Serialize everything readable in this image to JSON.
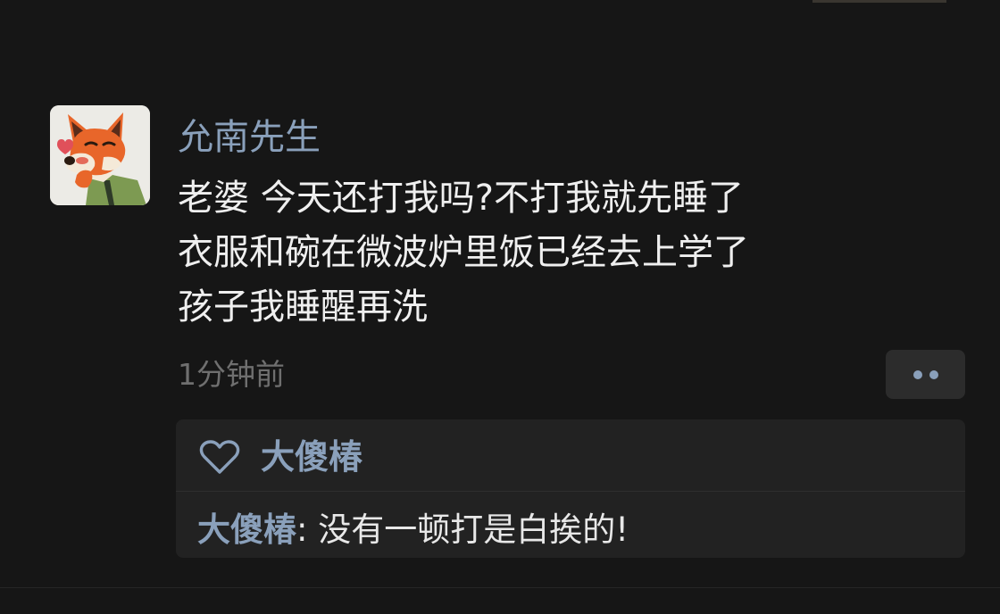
{
  "post": {
    "author": "允南先生",
    "body_lines": [
      "老婆 今天还打我吗?不打我就先睡了",
      "衣服和碗在微波炉里饭已经去上学了",
      "孩子我睡醒再洗"
    ],
    "timestamp": "1分钟前",
    "avatar_icon": "fox-cartoon-avatar",
    "more_icon": "two-dots-icon"
  },
  "interactions": {
    "like_icon": "heart-outline-icon",
    "likers": "大傻椿",
    "comments": [
      {
        "author": "大傻椿",
        "separator": ": ",
        "text": "没有一顿打是白挨的!"
      }
    ]
  },
  "colors": {
    "background": "#161616",
    "link_blue": "#8aa0bb",
    "text": "#efefef",
    "muted": "#6f6f6f",
    "panel": "#222222"
  }
}
